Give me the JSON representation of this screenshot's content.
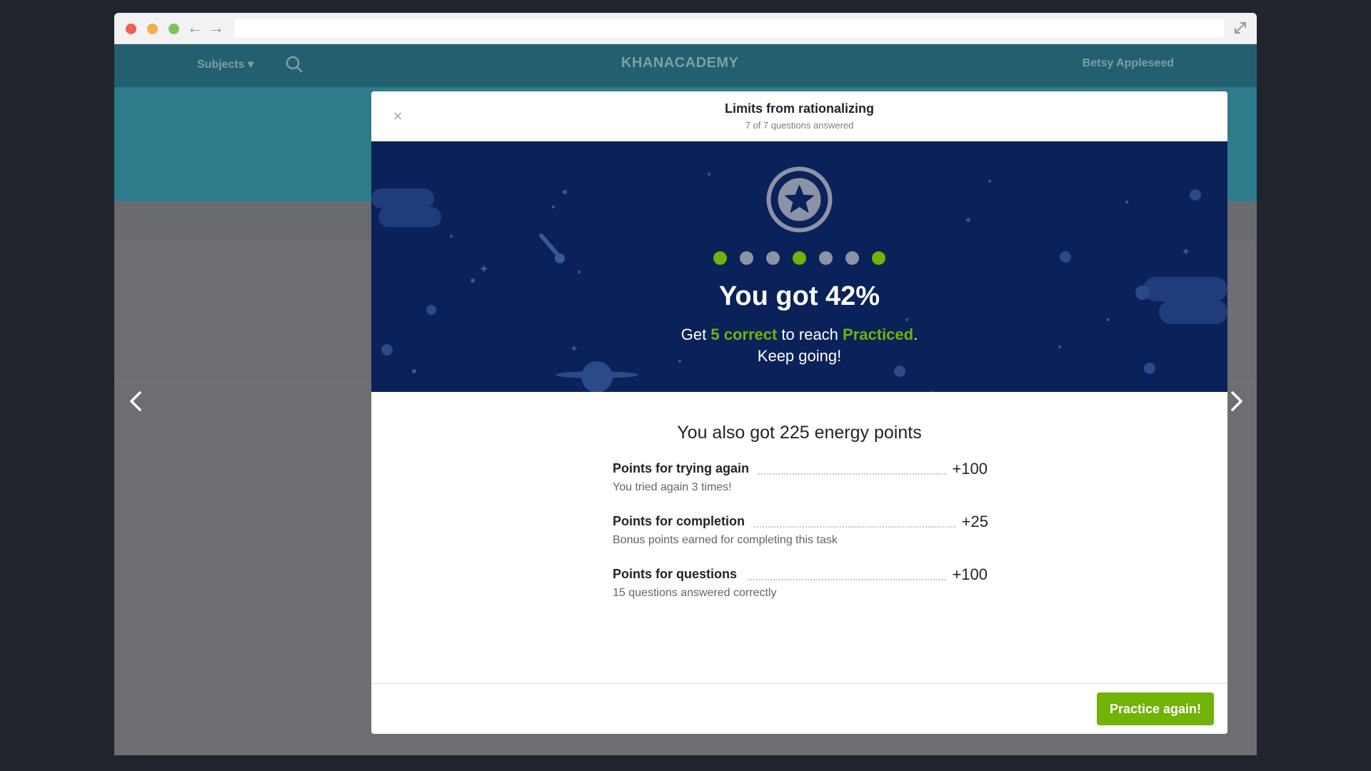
{
  "site": {
    "subjects_label": "Subjects",
    "logo_text": "KHANACADEMY",
    "user_name": "Betsy Appleseed"
  },
  "modal": {
    "title": "Limits from rationalizing",
    "subtitle": "7 of 7 questions answered",
    "close_icon": "×",
    "question_results": [
      "correct",
      "incorrect",
      "incorrect",
      "correct",
      "incorrect",
      "incorrect",
      "correct"
    ],
    "score_text": "You got 42%",
    "encourage": {
      "prefix": "Get ",
      "highlight_count": "5 correct",
      "middle": " to reach ",
      "highlight_level": "Practiced",
      "suffix": ".",
      "line2": "Keep going!"
    },
    "points_title": "You also got 225 energy points",
    "points": [
      {
        "label": "Points for trying again",
        "value": "+100",
        "detail": "You tried again 3 times!"
      },
      {
        "label": "Points for completion",
        "value": "+25",
        "detail": "Bonus points earned for completing this task"
      },
      {
        "label": "Points for questions",
        "value": "+100",
        "detail": "15 questions answered correctly"
      }
    ],
    "practice_button": "Practice again!"
  },
  "colors": {
    "accent_green": "#71b307",
    "space_blue": "#0a2159",
    "header_teal": "#23606f"
  },
  "icons": {
    "badge": "star-badge-icon",
    "close": "close-icon",
    "search": "search-icon",
    "carousel_left": "chevron-left-icon",
    "carousel_right": "chevron-right-icon"
  }
}
